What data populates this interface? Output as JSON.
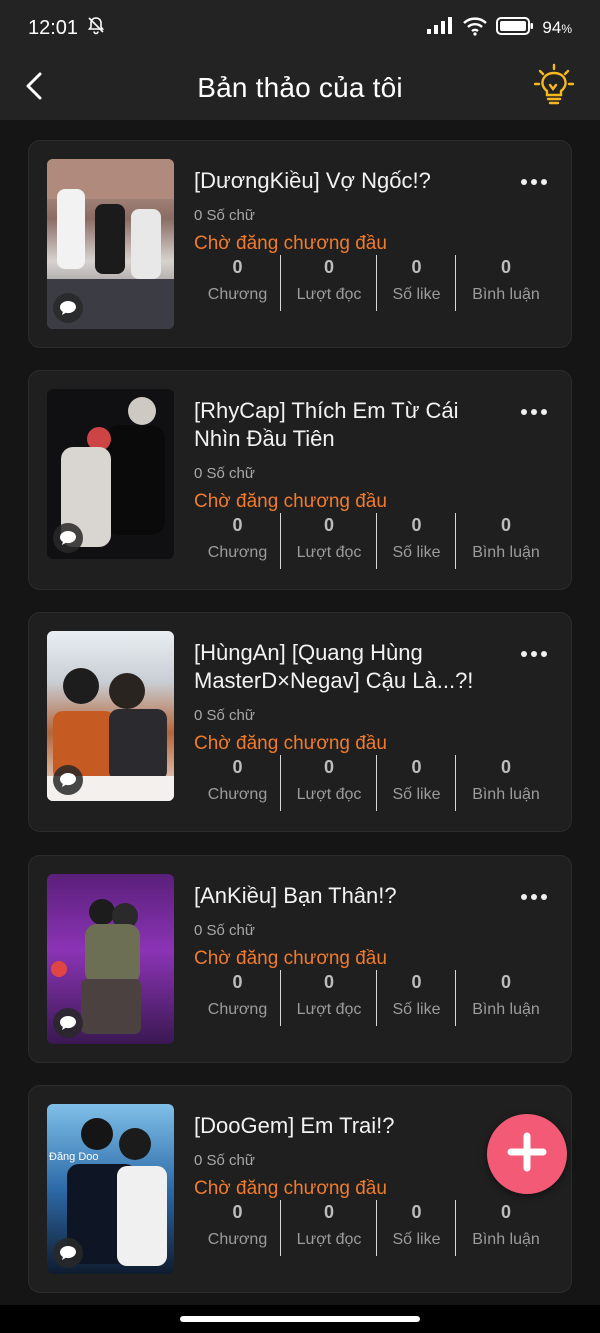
{
  "status_bar": {
    "time": "12:01",
    "battery": "94",
    "battery_unit": "%",
    "mute_icon": "bell-off-icon",
    "signal_icon": "signal-icon",
    "wifi_icon": "wifi-icon",
    "battery_icon": "battery-icon"
  },
  "header": {
    "title": "Bản thảo của tôi",
    "back_icon": "chevron-left-icon",
    "tip_icon": "lightbulb-icon"
  },
  "colors": {
    "accent": "#f07b2d",
    "fab": "#f25a76",
    "bulb": "#f5b91f"
  },
  "drafts": [
    {
      "title": "[DươngKiều] Vợ Ngốc!?",
      "word_count": "0 Số chữ",
      "status": "Chờ đăng chương đầu",
      "stats": [
        {
          "value": "0",
          "label": "Chương"
        },
        {
          "value": "0",
          "label": "Lượt đọc"
        },
        {
          "value": "0",
          "label": "Số like"
        },
        {
          "value": "0",
          "label": "Bình luận"
        }
      ]
    },
    {
      "title": "[RhyCap] Thích Em Từ Cái Nhìn Đầu Tiên",
      "word_count": "0 Số chữ",
      "status": "Chờ đăng chương đầu",
      "stats": [
        {
          "value": "0",
          "label": "Chương"
        },
        {
          "value": "0",
          "label": "Lượt đọc"
        },
        {
          "value": "0",
          "label": "Số like"
        },
        {
          "value": "0",
          "label": "Bình luận"
        }
      ]
    },
    {
      "title": "[HùngAn] [Quang Hùng MasterD×Negav] Cậu Là...?!",
      "word_count": "0 Số chữ",
      "status": "Chờ đăng chương đầu",
      "stats": [
        {
          "value": "0",
          "label": "Chương"
        },
        {
          "value": "0",
          "label": "Lượt đọc"
        },
        {
          "value": "0",
          "label": "Số like"
        },
        {
          "value": "0",
          "label": "Bình luận"
        }
      ]
    },
    {
      "title": "[AnKiều] Bạn Thân!?",
      "word_count": "0 Số chữ",
      "status": "Chờ đăng chương đầu",
      "stats": [
        {
          "value": "0",
          "label": "Chương"
        },
        {
          "value": "0",
          "label": "Lượt đọc"
        },
        {
          "value": "0",
          "label": "Số like"
        },
        {
          "value": "0",
          "label": "Bình luận"
        }
      ]
    },
    {
      "title": "[DooGem] Em Trai!?",
      "word_count": "0 Số chữ",
      "status": "Chờ đăng chương đầu",
      "thumb_text": "Đăng Doo",
      "stats": [
        {
          "value": "0",
          "label": "Chương"
        },
        {
          "value": "0",
          "label": "Lượt đọc"
        },
        {
          "value": "0",
          "label": "Số like"
        },
        {
          "value": "0",
          "label": "Bình luận"
        }
      ]
    }
  ],
  "fab_icon": "plus-icon",
  "more_icon": "more-horizontal-icon",
  "comment_icon": "comment-bubble-icon"
}
